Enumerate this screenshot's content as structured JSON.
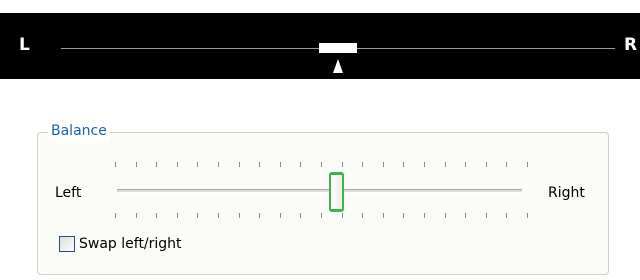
{
  "top_balance": {
    "left_label": "L",
    "right_label": "R",
    "position": 0.5,
    "colors": {
      "background": "#000000",
      "foreground": "#ffffff"
    }
  },
  "balance_group": {
    "title": "Balance",
    "left_label": "Left",
    "right_label": "Right",
    "tick_count": 21,
    "slider_position": 0.54,
    "swap": {
      "label": "Swap left/right",
      "checked": false
    },
    "colors": {
      "title": "#1f5fb4",
      "thumb_border": "#3cb34e",
      "checkbox_border": "#1c5180"
    }
  }
}
